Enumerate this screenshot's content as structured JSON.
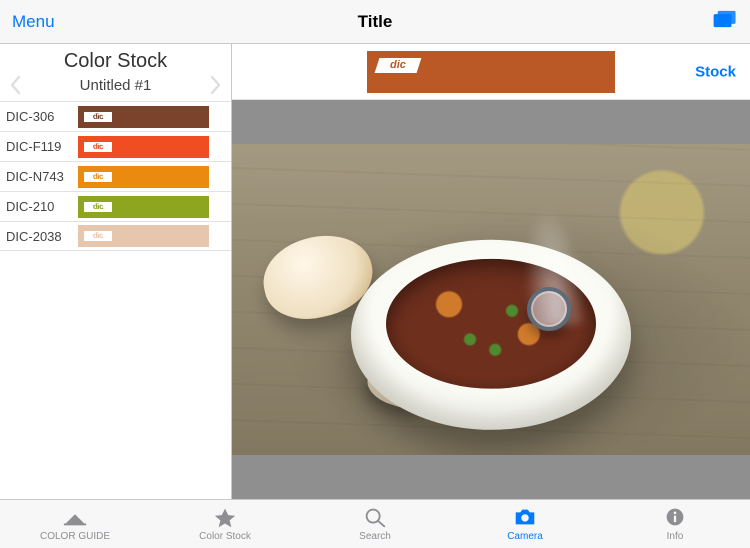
{
  "accent": "#007aff",
  "navbar": {
    "menu_label": "Menu",
    "title": "Title"
  },
  "sidebar": {
    "title": "Color Stock",
    "palette_name": "Untitled #1",
    "items": [
      {
        "label": "DIC-306",
        "color": "#7b432b"
      },
      {
        "label": "DIC-F119",
        "color": "#f04e22"
      },
      {
        "label": "DIC-N743",
        "color": "#ea8b0f"
      },
      {
        "label": "DIC-210",
        "color": "#8ea61f"
      },
      {
        "label": "DIC-2038",
        "color": "#e7c6ae"
      }
    ]
  },
  "detail": {
    "selected_color": "#ba5826",
    "stock_label": "Stock"
  },
  "tabs": [
    {
      "id": "color-guide",
      "label": "COLOR GUIDE"
    },
    {
      "id": "color-stock",
      "label": "Color Stock"
    },
    {
      "id": "search",
      "label": "Search"
    },
    {
      "id": "camera",
      "label": "Camera"
    },
    {
      "id": "info",
      "label": "Info"
    }
  ],
  "active_tab": "camera"
}
